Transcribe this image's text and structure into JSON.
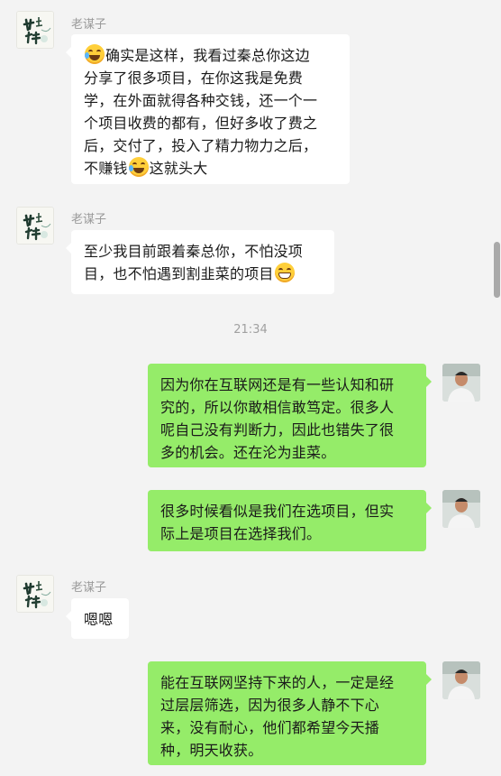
{
  "messages": [
    {
      "side": "left",
      "sender": "老谋子",
      "lines": [
        [
          "emoji:laugh-tears",
          "确实是这样，我看过秦总你这边"
        ],
        [
          "分享了很多项目，在你这我是免费"
        ],
        [
          "学，在外面就得各种交钱，还一个一"
        ],
        [
          "个项目收费的都有，但好多收了费之"
        ],
        [
          "后，交付了，投入了精力物力之后，"
        ],
        [
          "不赚钱",
          "emoji:laugh-tears",
          "这就头大"
        ]
      ]
    },
    {
      "side": "left",
      "sender": "老谋子",
      "lines": [
        [
          "至少我目前跟着秦总你，不怕没项"
        ],
        [
          "目，也不怕遇到割韭菜的项目",
          "emoji:grin"
        ]
      ]
    },
    {
      "side": "right",
      "lines": [
        [
          "因为你在互联网还是有一些认知和研"
        ],
        [
          "究的，所以你敢相信敢笃定。很多人"
        ],
        [
          "呢自己没有判断力，因此也错失了很"
        ],
        [
          "多的机会。还在沦为韭菜。"
        ]
      ]
    },
    {
      "side": "right",
      "lines": [
        [
          "很多时候看似是我们在选项目，但实"
        ],
        [
          "际上是项目在选择我们。"
        ]
      ]
    },
    {
      "side": "left",
      "sender": "老谋子",
      "lines": [
        [
          "嗯嗯"
        ]
      ]
    },
    {
      "side": "right",
      "lines": [
        [
          "能在互联网坚持下来的人，一定是经"
        ],
        [
          "过层层筛选，因为很多人静不下心"
        ],
        [
          "来，没有耐心，他们都希望今天播"
        ],
        [
          "种，明天收获。"
        ]
      ]
    }
  ],
  "timestamp": "21:34",
  "colors": {
    "background": "#f3f3f3",
    "bubble_left": "#ffffff",
    "bubble_right": "#95ec69",
    "sender_text": "#9a9a9a",
    "timestamp_text": "#a0a0a0"
  },
  "icons": {
    "laugh_tears": "face-with-tears-of-joy",
    "grin": "grinning-face",
    "avatar_left": "calligraphy-avatar",
    "avatar_right": "person-photo-avatar"
  }
}
